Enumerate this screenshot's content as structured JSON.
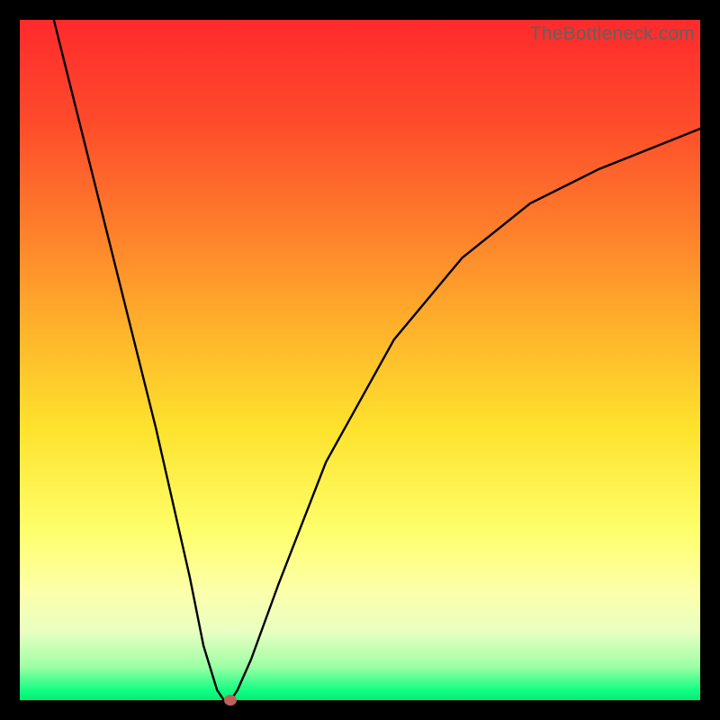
{
  "watermark": "TheBottleneck.com",
  "chart_data": {
    "type": "line",
    "title": "",
    "xlabel": "",
    "ylabel": "",
    "xlim": [
      0,
      100
    ],
    "ylim": [
      0,
      100
    ],
    "grid": false,
    "legend": false,
    "series": [
      {
        "name": "curve",
        "x": [
          5,
          10,
          15,
          20,
          25,
          27,
          29,
          30,
          31,
          32,
          34,
          38,
          45,
          55,
          65,
          75,
          85,
          95,
          100
        ],
        "values": [
          100,
          80,
          60,
          40,
          18,
          8,
          1.5,
          0,
          0,
          1.5,
          6,
          17,
          35,
          53,
          65,
          73,
          78,
          82,
          84
        ]
      }
    ],
    "marker": {
      "x": 31,
      "y": 0
    },
    "background_gradient": {
      "top": "#fe2a2c",
      "mid": "#fee22d",
      "bottom": "#00ed74"
    }
  }
}
